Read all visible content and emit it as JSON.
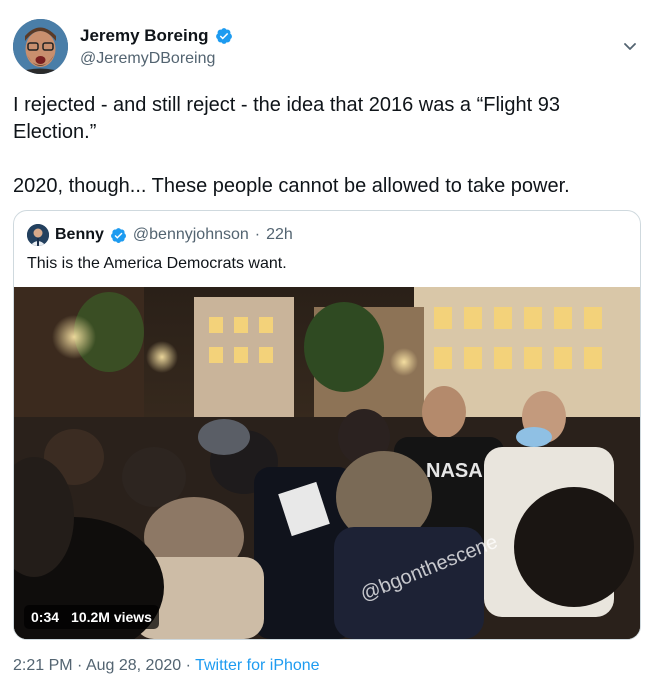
{
  "author": {
    "name": "Jeremy Boreing",
    "handle": "@JeremyDBoreing"
  },
  "tweet": {
    "text": "I rejected - and still reject - the idea that 2016 was a “Flight 93 Election.”\n\n2020, though... These people cannot be allowed to take power."
  },
  "quoted": {
    "name": "Benny",
    "handle": "@bennyjohnson",
    "separator": "·",
    "age": "22h",
    "text": "This is the America Democrats want.",
    "video": {
      "duration": "0:34",
      "views": "10.2M views",
      "watermark": "@bgonthescene",
      "shirt_text": "NASA"
    }
  },
  "footer": {
    "time": "2:21 PM",
    "sep1": "·",
    "date": "Aug 28, 2020",
    "sep2": "·",
    "source": "Twitter for iPhone"
  },
  "colors": {
    "verified": "#1d9bf0",
    "link": "#1d9bf0",
    "muted": "#536471",
    "border": "#cfd9de"
  },
  "icons": [
    "verified-badge-icon",
    "chevron-down-icon",
    "play-video"
  ]
}
